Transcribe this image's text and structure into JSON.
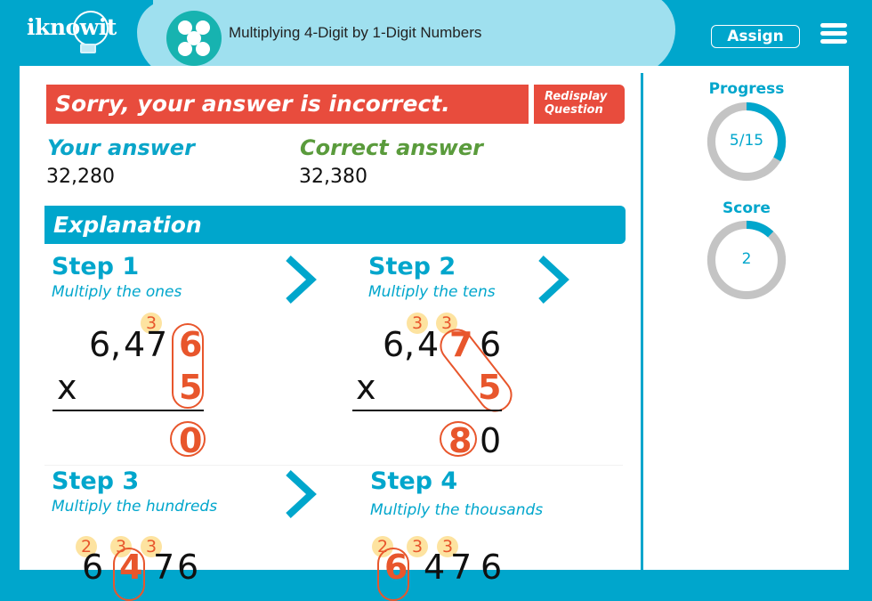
{
  "header": {
    "logo": "iknowit",
    "topic_icon": "dice-five-icon",
    "title": "Multiplying 4-Digit by 1-Digit Numbers",
    "assign_label": "Assign",
    "menu_icon": "hamburger-menu-icon"
  },
  "feedback": {
    "message": "Sorry, your answer is incorrect.",
    "redisplay_line1": "Redisplay",
    "redisplay_line2": "Question",
    "your_answer_label": "Your answer",
    "your_answer_value": "32,280",
    "correct_answer_label": "Correct answer",
    "correct_answer_value": "32,380",
    "colors": {
      "incorrect": "#e84c3d",
      "your": "#0aa5c9",
      "correct": "#5a9b3c"
    }
  },
  "explanation": {
    "title": "Explanation",
    "steps": [
      {
        "title": "Step 1",
        "subtitle": "Multiply the ones",
        "carries": [
          "3"
        ],
        "top": [
          "6",
          ",",
          "4",
          "7",
          "6"
        ],
        "times": "x",
        "multiplier": "5",
        "result": [
          "0"
        ]
      },
      {
        "title": "Step 2",
        "subtitle": "Multiply the tens",
        "carries": [
          "3",
          "3"
        ],
        "top": [
          "6",
          ",",
          "4",
          "7",
          "6"
        ],
        "times": "x",
        "multiplier": "5",
        "result": [
          "8",
          "0"
        ]
      },
      {
        "title": "Step 3",
        "subtitle": "Multiply the hundreds",
        "carries": [
          "2",
          "3",
          "3"
        ],
        "top": [
          "6",
          ",",
          "4",
          "7",
          "6"
        ]
      },
      {
        "title": "Step 4",
        "subtitle": "Multiply the thousands",
        "carries": [
          "2",
          "3",
          "3"
        ],
        "top": [
          "6",
          ",",
          "4",
          "7",
          "6"
        ]
      }
    ]
  },
  "sidebar": {
    "progress_label": "Progress",
    "progress_text": "5/15",
    "progress_fraction": 0.333,
    "score_label": "Score",
    "score_text": "2",
    "score_fraction": 0.12,
    "colors": {
      "ring_fill": "#00a6cc",
      "ring_track": "#c4c4c4"
    }
  }
}
